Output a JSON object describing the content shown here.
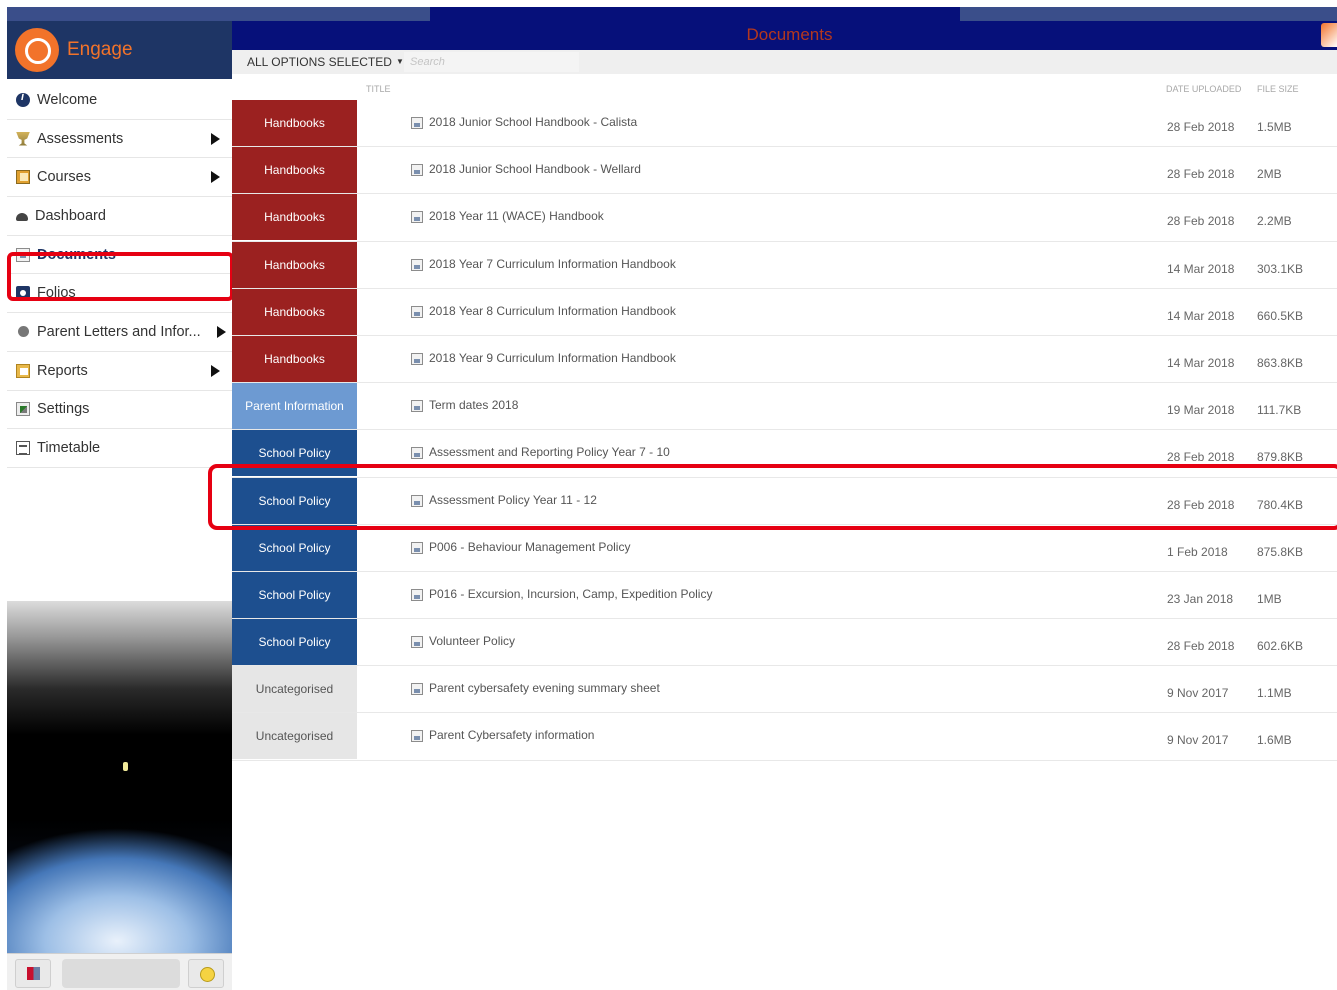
{
  "app": {
    "name": "Engage"
  },
  "colors": {
    "brand_orange": "#f2732a",
    "navy": "#1e3565",
    "title_bar": "#06107a",
    "handbooks": "#9b2120",
    "parent_information": "#6d9ad2",
    "school_policy": "#1d4f8f",
    "uncategorised": "#e6e6e6",
    "highlight": "#e60012"
  },
  "sidebar": {
    "items": [
      {
        "label": "Welcome",
        "icon": "info-icon",
        "has_submenu": false
      },
      {
        "label": "Assessments",
        "icon": "trophy-icon",
        "has_submenu": true
      },
      {
        "label": "Courses",
        "icon": "book-icon",
        "has_submenu": true
      },
      {
        "label": "Dashboard",
        "icon": "dashboard-icon",
        "has_submenu": false
      },
      {
        "label": "Documents",
        "icon": "document-icon",
        "has_submenu": false,
        "active": true
      },
      {
        "label": "Folios",
        "icon": "folio-icon",
        "has_submenu": false
      },
      {
        "label": "Parent Letters and Infor...",
        "icon": "letter-icon",
        "has_submenu": true
      },
      {
        "label": "Reports",
        "icon": "report-icon",
        "has_submenu": true
      },
      {
        "label": "Settings",
        "icon": "settings-icon",
        "has_submenu": false
      },
      {
        "label": "Timetable",
        "icon": "timetable-icon",
        "has_submenu": false
      }
    ]
  },
  "main": {
    "title": "Documents",
    "filter": {
      "label": "ALL OPTIONS SELECTED",
      "search_placeholder": "Search"
    },
    "columns": {
      "title": "TITLE",
      "date": "DATE UPLOADED",
      "size": "FILE SIZE"
    },
    "rows": [
      {
        "category": "Handbooks",
        "title": "2018 Junior School Handbook - Calista",
        "date": "28 Feb 2018",
        "size": "1.5MB"
      },
      {
        "category": "Handbooks",
        "title": "2018 Junior School Handbook - Wellard",
        "date": "28 Feb 2018",
        "size": "2MB"
      },
      {
        "category": "Handbooks",
        "title": "2018 Year 11 (WACE) Handbook",
        "date": "28 Feb 2018",
        "size": "2.2MB"
      },
      {
        "category": "Handbooks",
        "title": "2018 Year 7 Curriculum Information Handbook",
        "date": "14 Mar 2018",
        "size": "303.1KB"
      },
      {
        "category": "Handbooks",
        "title": "2018 Year 8 Curriculum Information Handbook",
        "date": "14 Mar 2018",
        "size": "660.5KB"
      },
      {
        "category": "Handbooks",
        "title": "2018 Year 9 Curriculum Information Handbook",
        "date": "14 Mar 2018",
        "size": "863.8KB"
      },
      {
        "category": "Parent Information",
        "title": "Term dates 2018",
        "date": "19 Mar 2018",
        "size": "111.7KB"
      },
      {
        "category": "School Policy",
        "title": "Assessment and Reporting Policy Year 7 - 10",
        "date": "28 Feb 2018",
        "size": "879.8KB"
      },
      {
        "category": "School Policy",
        "title": "Assessment Policy Year 11 - 12",
        "date": "28 Feb 2018",
        "size": "780.4KB",
        "highlighted": true
      },
      {
        "category": "School Policy",
        "title": "P006 - Behaviour Management Policy",
        "date": "1 Feb 2018",
        "size": "875.8KB"
      },
      {
        "category": "School Policy",
        "title": "P016 - Excursion, Incursion, Camp, Expedition Policy",
        "date": "23 Jan 2018",
        "size": "1MB"
      },
      {
        "category": "School Policy",
        "title": "Volunteer Policy",
        "date": "28 Feb 2018",
        "size": "602.6KB"
      },
      {
        "category": "Uncategorised",
        "title": "Parent cybersafety evening summary sheet",
        "date": "9 Nov 2017",
        "size": "1.1MB"
      },
      {
        "category": "Uncategorised",
        "title": "Parent Cybersafety information",
        "date": "9 Nov 2017",
        "size": "1.6MB"
      }
    ]
  }
}
